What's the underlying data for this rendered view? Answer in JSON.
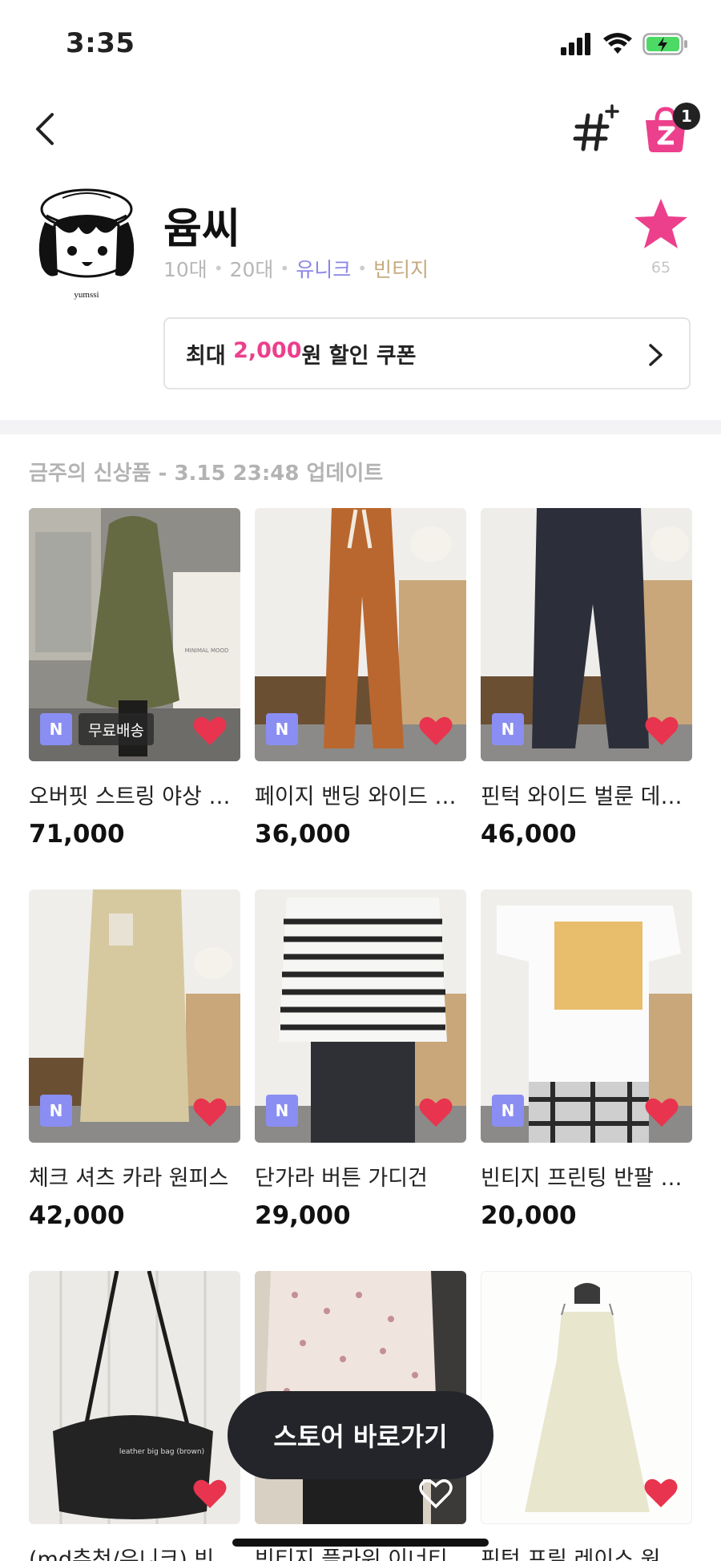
{
  "status": {
    "time": "3:35"
  },
  "nav": {
    "cart_count": "1"
  },
  "store": {
    "name": "윰씨",
    "tags": [
      {
        "text": "10대",
        "tone": "gray"
      },
      {
        "text": "20대",
        "tone": "gray"
      },
      {
        "text": "유니크",
        "tone": "purple"
      },
      {
        "text": "빈티지",
        "tone": "beige"
      }
    ],
    "favorite_count": "65",
    "avatar_caption": "yumssi"
  },
  "coupon": {
    "prefix": "최대 ",
    "amount": "2,000",
    "suffix": "원 할인 쿠폰"
  },
  "section": {
    "title": "금주의 신상품 - 3.15 23:48 업데이트"
  },
  "products": [
    {
      "name": "오버핏 스트링 야상 코트",
      "price": "71,000",
      "badge": "N",
      "free_shipping": "무료배송",
      "liked": true,
      "img_caption": "MINIMAL MOOD"
    },
    {
      "name": "페이지 밴딩 와이드 팬츠",
      "price": "36,000",
      "badge": "N",
      "liked": true
    },
    {
      "name": "핀턱 와이드 벌룬 데님 팬츠",
      "price": "46,000",
      "badge": "N",
      "liked": true
    },
    {
      "name": "체크 셔츠 카라 원피스",
      "price": "42,000",
      "badge": "N",
      "liked": true
    },
    {
      "name": "단가라 버튼 가디건",
      "price": "29,000",
      "badge": "N",
      "liked": true
    },
    {
      "name": "빈티지 프린팅 반팔 티셔츠",
      "price": "20,000",
      "badge": "N",
      "liked": true
    },
    {
      "name": "(md추천/유니크) 빈티지 가방",
      "price": "",
      "badge": "",
      "liked": true,
      "img_caption": "leather big bag (brown)"
    },
    {
      "name": "빈티지 플라워 이너티",
      "price": "",
      "badge": "",
      "liked": false
    },
    {
      "name": "핀턱 프릴 레이스 원피스",
      "price": "",
      "badge": "",
      "liked": true
    }
  ],
  "cta": {
    "label": "스토어 바로가기"
  },
  "colors": {
    "accent_pink": "#ec3f8c",
    "badge_purple": "#8a8ef2",
    "heart_red": "#e8344e"
  }
}
